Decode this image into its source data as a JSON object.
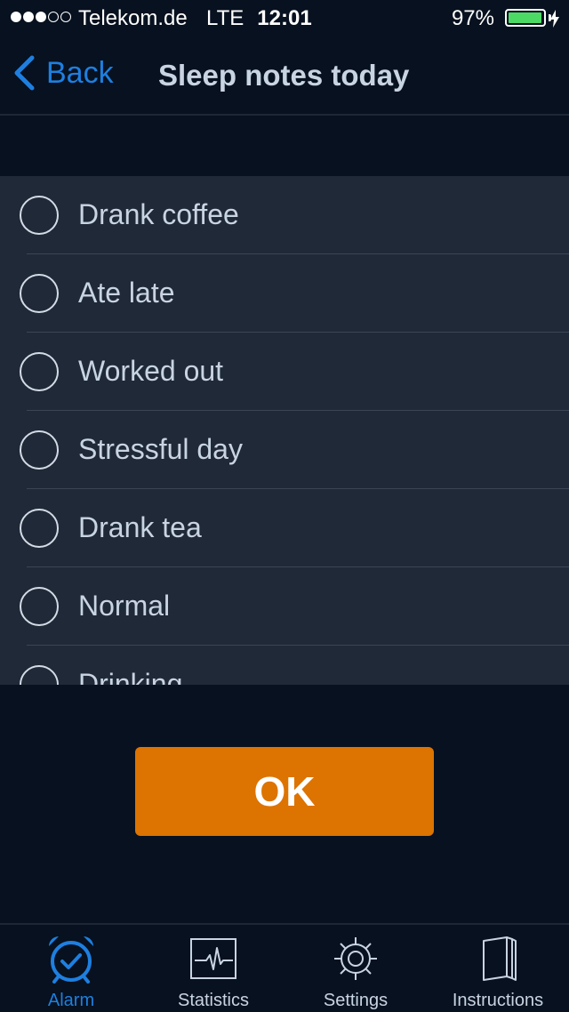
{
  "status_bar": {
    "carrier": "Telekom.de",
    "network": "LTE",
    "time": "12:01",
    "battery": "97%",
    "battery_level": 0.97
  },
  "nav": {
    "back_label": "Back",
    "title": "Sleep notes today"
  },
  "notes": [
    {
      "label": "Drank coffee",
      "checked": false
    },
    {
      "label": "Ate late",
      "checked": false
    },
    {
      "label": "Worked out",
      "checked": false
    },
    {
      "label": "Stressful day",
      "checked": false
    },
    {
      "label": "Drank tea",
      "checked": false
    },
    {
      "label": "Normal",
      "checked": false
    },
    {
      "label": "Drinking",
      "checked": false
    }
  ],
  "ok_label": "OK",
  "tabs": [
    {
      "label": "Alarm",
      "icon": "alarm-clock-icon",
      "active": true
    },
    {
      "label": "Statistics",
      "icon": "pulse-chart-icon",
      "active": false
    },
    {
      "label": "Settings",
      "icon": "gear-icon",
      "active": false
    },
    {
      "label": "Instructions",
      "icon": "book-icon",
      "active": false
    }
  ],
  "colors": {
    "accent": "#1e7fe0",
    "ok_button": "#dd7300",
    "background": "#07111f",
    "list_background": "#1f2938",
    "battery": "#4cd964"
  }
}
